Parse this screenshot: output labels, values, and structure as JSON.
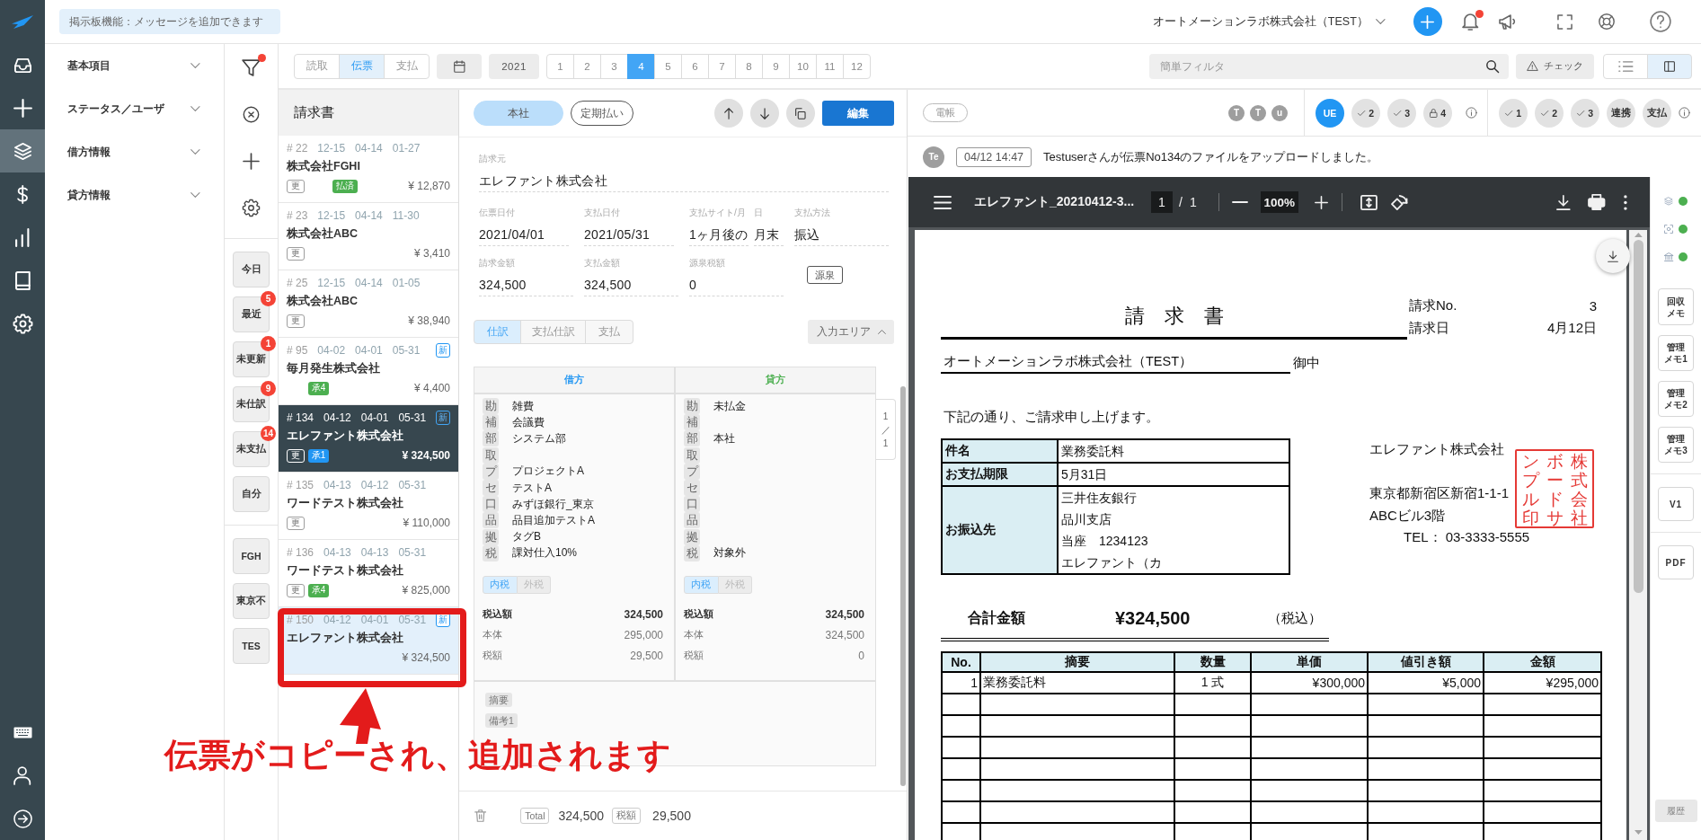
{
  "nav": {
    "items": [
      {
        "selected": false
      },
      {
        "selected": false
      },
      {
        "selected": true
      },
      {
        "selected": false
      },
      {
        "selected": false
      },
      {
        "selected": false
      },
      {
        "selected": false
      }
    ]
  },
  "header": {
    "notice": "掲示板機能：メッセージを追加できます",
    "company": "オートメーションラボ株式会社（TEST）",
    "unread": true
  },
  "sidebar": {
    "sections": [
      {
        "label": "基本項目",
        "expanded": false
      },
      {
        "label": "ステータス／ユーザ",
        "expanded": false
      },
      {
        "label": "借方情報",
        "expanded": false
      },
      {
        "label": "貸方情報",
        "expanded": false
      }
    ]
  },
  "filters": {
    "active": true,
    "quick": [
      {
        "label": "今日"
      },
      {
        "label": "最近",
        "count": "5"
      },
      {
        "label": "未更新",
        "count": "1"
      },
      {
        "label": "未仕訳",
        "count": "9"
      },
      {
        "label": "未支払",
        "count": "14"
      },
      {
        "label": "自分"
      }
    ],
    "saved": [
      {
        "label": "FGH"
      },
      {
        "label": "東京不"
      },
      {
        "label": "TES"
      }
    ]
  },
  "toolbar": {
    "modes": [
      {
        "label": "読取",
        "selected": false
      },
      {
        "label": "伝票",
        "selected": true
      },
      {
        "label": "支払",
        "selected": false
      }
    ],
    "year": "2021",
    "months": [
      {
        "label": "1",
        "selected": false
      },
      {
        "label": "2",
        "selected": false
      },
      {
        "label": "3",
        "selected": false
      },
      {
        "label": "4",
        "selected": true
      },
      {
        "label": "5",
        "selected": false
      },
      {
        "label": "6",
        "selected": false
      },
      {
        "label": "7",
        "selected": false
      },
      {
        "label": "8",
        "selected": false
      },
      {
        "label": "9",
        "selected": false
      },
      {
        "label": "10",
        "selected": false
      },
      {
        "label": "11",
        "selected": false
      },
      {
        "label": "12",
        "selected": false
      }
    ],
    "search": {
      "placeholder": "簡単フィルタ"
    },
    "check": "チェック",
    "views": [
      {
        "selected": false
      },
      {
        "selected": true
      }
    ]
  },
  "list": {
    "title": "請求書",
    "items": [
      {
        "number": "# 22",
        "dates": [
          "12-15",
          "04-14",
          "01-27"
        ],
        "name": "株式会社FGHI",
        "tags": [
          {
            "kind": "update",
            "label": "更"
          },
          {
            "kind": "paid",
            "label": "払済",
            "color": "#4caf50"
          }
        ],
        "amount": "¥ 12,870",
        "selected": false,
        "highlighted": false
      },
      {
        "number": "# 23",
        "dates": [
          "12-15",
          "04-14",
          "11-30"
        ],
        "name": "株式会社ABC",
        "tags": [
          {
            "kind": "update",
            "label": "更"
          }
        ],
        "amount": "¥ 3,410",
        "selected": false,
        "highlighted": false
      },
      {
        "number": "# 25",
        "dates": [
          "12-15",
          "04-14",
          "01-05"
        ],
        "name": "株式会社ABC",
        "tags": [
          {
            "kind": "update",
            "label": "更"
          }
        ],
        "amount": "¥ 38,940",
        "selected": false,
        "highlighted": false
      },
      {
        "number": "# 95",
        "dates": [
          "04-02",
          "04-01",
          "05-31"
        ],
        "badge": "新",
        "name": "毎月発生株式会社",
        "tags": [
          {
            "kind": "approval",
            "label": "承4",
            "color": "#4caf50"
          }
        ],
        "amount": "¥ 4,400",
        "selected": false,
        "highlighted": false
      },
      {
        "number": "# 134",
        "dates": [
          "04-12",
          "04-01",
          "05-31"
        ],
        "badge": "新",
        "name": "エレファント株式会社",
        "tags": [
          {
            "kind": "update",
            "label": "更"
          },
          {
            "kind": "approval",
            "label": "承1",
            "color": "#2196f3"
          }
        ],
        "amount": "¥ 324,500",
        "selected": true,
        "highlighted": false
      },
      {
        "number": "# 135",
        "dates": [
          "04-13",
          "04-12",
          "05-31"
        ],
        "name": "ワードテスト株式会社",
        "tags": [
          {
            "kind": "update",
            "label": "更"
          }
        ],
        "amount": "¥ 110,000",
        "selected": false,
        "highlighted": false
      },
      {
        "number": "# 136",
        "dates": [
          "04-13",
          "04-13",
          "05-31"
        ],
        "name": "ワードテスト株式会社",
        "tags": [
          {
            "kind": "update",
            "label": "更"
          },
          {
            "kind": "approval",
            "label": "承4",
            "color": "#4caf50"
          }
        ],
        "amount": "¥ 825,000",
        "selected": false,
        "highlighted": false
      },
      {
        "number": "# 150",
        "dates": [
          "04-12",
          "04-01",
          "05-31"
        ],
        "badge": "新",
        "name": "エレファント株式会社",
        "amount": "¥ 324,500",
        "selected": false,
        "highlighted": true
      }
    ]
  },
  "detail": {
    "chips": [
      {
        "label": "本社",
        "selected": true
      },
      {
        "label": "定期払い",
        "selected": false
      }
    ],
    "edit": "編集",
    "field_rows": [
      [
        {
          "label": "請求元",
          "value": "エレファント株式会社"
        }
      ],
      [
        {
          "label": "伝票日付",
          "value": "2021/04/01"
        },
        {
          "label": "支払日付",
          "value": "2021/05/31"
        },
        {
          "label": "支払サイト/月",
          "value": "1ヶ月後の"
        },
        {
          "label": "日",
          "value": "月末"
        },
        {
          "label": "支払方法",
          "value": "振込"
        }
      ],
      [
        {
          "label": "請求金額",
          "value": "324,500"
        },
        {
          "label": "支払金額",
          "value": "324,500"
        },
        {
          "label": "源泉税額",
          "value": "0"
        }
      ]
    ],
    "withholding": "源泉",
    "tabs": [
      {
        "label": "仕訳",
        "selected": true
      },
      {
        "label": "支払仕訳",
        "selected": false
      },
      {
        "label": "支払",
        "selected": false
      }
    ],
    "input_area": {
      "label": "入力エリア",
      "expanded": true
    },
    "journal": {
      "sides": [
        {
          "title": "借方",
          "color": "#2196f3",
          "lines": [
            {
              "tag": "勘",
              "value": "雑費"
            },
            {
              "tag": "補",
              "value": "会議費"
            },
            {
              "tag": "部",
              "value": "システム部"
            },
            {
              "tag": "取"
            },
            {
              "tag": "プ",
              "value": "プロジェクトA"
            },
            {
              "tag": "セ",
              "value": "テストA"
            },
            {
              "tag": "口",
              "value": "みずほ銀行_東京"
            },
            {
              "tag": "品",
              "value": "品目追加テストA"
            },
            {
              "tag": "拠",
              "value": "タグB"
            },
            {
              "tag": "税",
              "value": "課対仕入10%"
            }
          ],
          "tax_modes": [
            {
              "label": "内税",
              "selected": true
            },
            {
              "label": "外税",
              "selected": false
            }
          ],
          "totals": [
            {
              "label": "税込額",
              "value": "324,500"
            },
            {
              "label": "本体",
              "value": "295,000"
            },
            {
              "label": "税額",
              "value": "29,500"
            }
          ]
        },
        {
          "title": "貸方",
          "color": "#4caf50",
          "lines": [
            {
              "tag": "勘",
              "value": "未払金"
            },
            {
              "tag": "補"
            },
            {
              "tag": "部",
              "value": "本社"
            },
            {
              "tag": "取"
            },
            {
              "tag": "プ"
            },
            {
              "tag": "セ"
            },
            {
              "tag": "口"
            },
            {
              "tag": "品"
            },
            {
              "tag": "拠"
            },
            {
              "tag": "税",
              "value": "対象外"
            }
          ],
          "tax_modes": [
            {
              "label": "内税",
              "selected": true
            },
            {
              "label": "外税",
              "selected": false
            }
          ],
          "totals": [
            {
              "label": "税込額",
              "value": "324,500"
            },
            {
              "label": "本体",
              "value": "324,500"
            },
            {
              "label": "税額",
              "value": "0"
            }
          ]
        }
      ],
      "pager": [
        "1",
        "／",
        "1"
      ]
    },
    "memo_tags": [
      "摘要",
      "備考1"
    ],
    "footer": {
      "total_label": "Total",
      "total": "324,500",
      "tax_label": "税額",
      "tax": "29,500"
    }
  },
  "viewer": {
    "ledger": "電帳",
    "users": [
      "T",
      "T",
      "u"
    ],
    "approvals": [
      {
        "label": "UE",
        "kind": "user",
        "active": true
      },
      {
        "label": "2",
        "kind": "check",
        "active": false
      },
      {
        "label": "3",
        "kind": "check",
        "active": false
      },
      {
        "label": "4",
        "kind": "lock",
        "active": false
      }
    ],
    "links": [
      {
        "label": "1",
        "kind": "check",
        "active": false
      },
      {
        "label": "2",
        "kind": "check",
        "active": false
      },
      {
        "label": "3",
        "kind": "check",
        "active": false
      },
      {
        "label": "連携",
        "kind": "text",
        "active": false
      },
      {
        "label": "支払",
        "kind": "text",
        "active": false
      }
    ],
    "message": {
      "avatar": "Te",
      "time": "04/12 14:47",
      "text": "Testuserさんが伝票No134のファイルをアップロードしました。"
    },
    "pdf": {
      "filename": "エレファント_20210412-3...",
      "page": "1",
      "separator": "/",
      "pages": "1",
      "zoom": "100%",
      "document": {
        "title": "請　求　書",
        "meta": [
          {
            "label": "請求No.",
            "value": "3"
          },
          {
            "label": "請求日",
            "value": "4月12日"
          }
        ],
        "recipient": "オートメーションラボ株式会社（TEST）",
        "honorific": "御中",
        "intro": "下記の通り、ご請求申し上げます。",
        "info": [
          {
            "label": "件名",
            "lines": [
              "業務委託料"
            ]
          },
          {
            "label": "お支払期限",
            "lines": [
              "5月31日"
            ]
          },
          {
            "label": "お振込先",
            "lines": [
              "三井住友銀行",
              "品川支店",
              "当座　1234123",
              "エレファント（カ"
            ]
          }
        ],
        "issuer": {
          "name": "エレファント株式会社",
          "address": [
            "東京都新宿区新宿1-1-1",
            "ABCビル3階"
          ],
          "tel": "TEL： 03-3333-5555"
        },
        "stamp": [
          "ンプル印",
          "ボードサ",
          "株式会社"
        ],
        "total": {
          "label": "合計金額",
          "amount": "¥324,500",
          "note": "（税込）"
        },
        "items": {
          "columns": [
            "No.",
            "摘要",
            "数量",
            "単価",
            "値引き額",
            "金額"
          ],
          "rows": [
            [
              "1",
              "業務委託料",
              "1 式",
              "¥300,000",
              "¥5,000",
              "¥295,000"
            ]
          ]
        }
      }
    },
    "side": {
      "indicators": [
        {
          "on": true
        },
        {
          "on": true
        },
        {
          "on": true
        }
      ],
      "memos": [
        [
          "回収",
          "メモ"
        ],
        [
          "管理",
          "メモ1"
        ],
        [
          "管理",
          "メモ2"
        ],
        [
          "管理",
          "メモ3"
        ]
      ],
      "version": "V1",
      "pdf": "PDF",
      "history": "履歴"
    }
  },
  "annotation": {
    "callout": "伝票がコピーされ、追加されます"
  }
}
